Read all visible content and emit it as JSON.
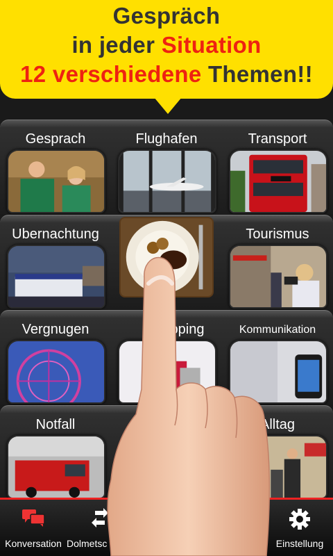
{
  "banner": {
    "line1": "Gespräch",
    "line2_a": "in jeder ",
    "line2_b": "Situation",
    "line3_a": "12 verschiedene",
    "line3_b": " Themen!!"
  },
  "tiles": [
    {
      "label": "Gesprach"
    },
    {
      "label": "Flughafen"
    },
    {
      "label": "Transport"
    },
    {
      "label": "Ubernachtung"
    },
    {
      "label": ""
    },
    {
      "label": "Tourismus"
    },
    {
      "label": "Vergnugen"
    },
    {
      "label": "pping"
    },
    {
      "label": "Kommunikation"
    },
    {
      "label": "Notfall"
    },
    {
      "label": ""
    },
    {
      "label": "Alltag"
    }
  ],
  "bottombar": {
    "items": [
      {
        "label": "Konversation",
        "icon": "chat-bubbles-icon"
      },
      {
        "label": "Dolmetsc",
        "icon": "swap-arrows-icon"
      },
      {
        "label": "Einstellung",
        "icon": "gear-icon"
      }
    ]
  },
  "colors": {
    "banner": "#ffe000",
    "accent_red": "#ee2211",
    "bar_border": "#ee2222"
  }
}
